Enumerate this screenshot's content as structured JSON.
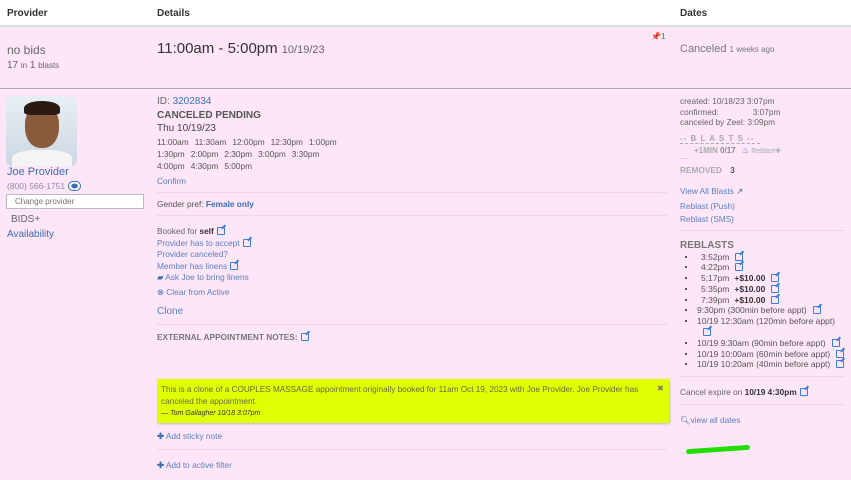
{
  "header": {
    "provider": "Provider",
    "details": "Details",
    "dates": "Dates"
  },
  "summary": {
    "bids": "no bids",
    "blast_count": "17",
    "in": "in",
    "blasts_n": "1",
    "blasts": "blasts",
    "time_range": "11:00am - 5:00pm",
    "date": "10/19/23",
    "pin_count": "1",
    "status": "Canceled",
    "ago": "1 weeks ago"
  },
  "provider": {
    "name": "Joe Provider",
    "phone": "(800) 566-1751",
    "change_placeholder": "Change provider",
    "bids": "BIDS",
    "bids_plus": "+",
    "availability": "Availability"
  },
  "details": {
    "id_label": "ID:",
    "id": "3202834",
    "status": "CANCELED PENDING",
    "day": "Thu 10/19/23",
    "times": [
      [
        "11:00am",
        "11:30am",
        "12:00pm",
        "12:30pm",
        "1:00pm"
      ],
      [
        "1:30pm",
        "2:00pm",
        "2:30pm",
        "3:00pm",
        "3:30pm"
      ],
      [
        "4:00pm",
        "4:30pm",
        "5:00pm"
      ]
    ],
    "confirm": "Confirm",
    "gender_label": "Gender pref:",
    "gender": "Female only",
    "booked_for_label": "Booked for",
    "booked_for": "self",
    "provider_accept": "Provider has to accept",
    "provider_canceled": "Provider canceled?",
    "member_linens": "Member has linens",
    "ask_linens": "Ask Joe to bring linens",
    "clear_active": "Clear from Active",
    "clone": "Clone",
    "external_notes": "EXTERNAL APPOINTMENT NOTES:",
    "note_text": "This is a clone of a COUPLES MASSAGE appointment originally booked for 11am Oct 19, 2023 with Joe Provider. Joe Provider has canceled the appointment.",
    "note_author": "— Tom Gallagher 10/18 3:07pm",
    "note_close": "✖",
    "add_sticky": "Add sticky note",
    "add_filter": "Add to active filter"
  },
  "dates": {
    "created": "created: 10/18/23 3:07pm",
    "confirmed_label": "confirmed:",
    "confirmed": "3:07pm",
    "canceled": "canceled by Zeel: 3:09pm",
    "blasts_header": "-- B L A S T S --",
    "blast_min": "+1MIN",
    "blast_ratio": "0/17",
    "reblast_small": "Reblast",
    "dash": "—",
    "removed_label": "REMOVED",
    "removed": "3",
    "view_all_blasts": "View All Blasts",
    "reblast_push": "Reblast (Push)",
    "reblast_sms": "Reblast (SMS)",
    "reblasts_title": "REBLASTS",
    "reblasts": [
      {
        "t": "3:52pm",
        "x": ""
      },
      {
        "t": "4:22pm",
        "x": ""
      },
      {
        "t": "5:17pm",
        "x": "+$10.00"
      },
      {
        "t": "5:35pm",
        "x": "+$10.00"
      },
      {
        "t": "7:39pm",
        "x": "+$10.00"
      },
      {
        "t": "9:30pm  (300min before appt)",
        "x": ""
      },
      {
        "t": "10/19 12:30am  (120min before appt)",
        "x": ""
      },
      {
        "t": "10/19 9:30am  (90min before appt)",
        "x": ""
      },
      {
        "t": "10/19 10:00am  (60min before appt)",
        "x": ""
      },
      {
        "t": "10/19 10:20am  (40min before appt)",
        "x": ""
      }
    ],
    "cancel_expire_label": "Cancel expire on",
    "cancel_expire": "10/19 4:30pm",
    "view_all_dates": "view all dates"
  },
  "colors": {
    "background": "#fde6f7",
    "link": "#3b6fb6",
    "note": "#e0ff00",
    "highlight": "#22dd00"
  }
}
